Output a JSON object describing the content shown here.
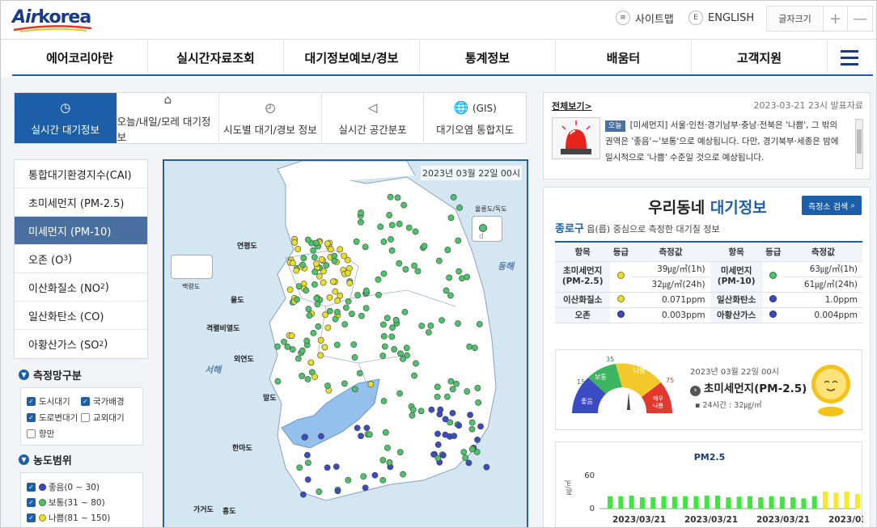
{
  "header": {
    "logo": "Airkorea",
    "sitemap": "사이트맵",
    "english": "ENGLISH",
    "english_icon": "E",
    "font_size": "글자크기",
    "font_plus": "+",
    "font_minus": "—"
  },
  "gnb": [
    "에어코리아란",
    "실시간자료조회",
    "대기정보예보/경보",
    "통계정보",
    "배움터",
    "고객지원"
  ],
  "tabs": [
    {
      "label": "실시간 대기정보",
      "icon": "clock-icon",
      "glyph": "◷"
    },
    {
      "label": "오늘/내일/모레 대기정보",
      "icon": "pin-icon",
      "glyph": "⌂"
    },
    {
      "label": "시도별 대기/경보 정보",
      "icon": "gauge-icon",
      "glyph": "◴"
    },
    {
      "label": "실시간 공간분포",
      "icon": "megaphone-icon",
      "glyph": "◁"
    },
    {
      "label": "대기오염 통합지도",
      "icon": "globe-icon",
      "glyph": "🌐",
      "gis": "(GIS)"
    }
  ],
  "left_menu": [
    {
      "label": "통합대기환경지수(CAI)"
    },
    {
      "label": "초미세먼지 (PM-2.5)"
    },
    {
      "label": "미세먼지 (PM-10)"
    },
    {
      "label": "오존 (O",
      "sub": "3",
      "end": ")"
    },
    {
      "label": "이산화질소 (NO",
      "sub": "2",
      "end": ")"
    },
    {
      "label": "일산화탄소 (CO)"
    },
    {
      "label": "아황산가스 (SO",
      "sub": "2",
      "end": ")"
    }
  ],
  "network": {
    "title": "측정망구분",
    "items": [
      {
        "label": "도시대기",
        "checked": true
      },
      {
        "label": "국가배경",
        "checked": true
      },
      {
        "label": "도로변대기",
        "checked": true
      },
      {
        "label": "교외대기",
        "checked": false
      },
      {
        "label": "항만",
        "checked": false
      }
    ]
  },
  "range": {
    "title": "농도범위",
    "items": [
      {
        "label": "좋음(0 ~ 30)",
        "color": "#3a4bc4",
        "checked": true
      },
      {
        "label": "보통(31 ~ 80)",
        "color": "#4cc36a",
        "checked": true
      },
      {
        "label": "나쁨(81 ~ 150)",
        "color": "#e8de2a",
        "checked": true
      }
    ]
  },
  "map": {
    "date": "2023년 03월 22일 00시",
    "labels": [
      "울릉도/독도",
      "연평도",
      "백령도",
      "울도",
      "격렬비열도",
      "외연도",
      "말도",
      "한마도",
      "가거도",
      "흥도"
    ],
    "seas": [
      "동해",
      "서해"
    ],
    "inset_text": "d"
  },
  "news": {
    "all": "전체보기>",
    "date": "2023-03-21 23시 발표자료",
    "badge": "오늘",
    "text": "[미세먼지] 서울·인천·경기남부·충남·전북은 '나쁨', 그 밖의 권역은 '좋음'~'보통'으로 예상됩니다. 다만, 경기북부·세종은 밤에 일시적으로 '나쁨' 수준일 것으로 예상됩니다."
  },
  "dong": {
    "title_a": "우리동네",
    "title_b": "대기정보",
    "search": "측정소 검색",
    "sub_region": "종로구",
    "sub_text": "읍(릅) 중심으로 측정한 대기질 정보",
    "headers": [
      "항목",
      "등급",
      "측정값",
      "항목",
      "등급",
      "측정값"
    ],
    "pm25": {
      "label": "초미세먼지\n(PM-2.5)",
      "v1": "39㎍/㎥(1h)",
      "v2": "32㎍/㎥(24h)",
      "color": "#e8de2a"
    },
    "pm10": {
      "label": "미세먼지\n(PM-10)",
      "v1": "63㎍/㎥(1h)",
      "v2": "61㎍/㎥(24h)",
      "color": "#4cc36a"
    },
    "no2": {
      "label": "이산화질소",
      "v": "0.071ppm",
      "color": "#e8de2a"
    },
    "co": {
      "label": "일산화탄소",
      "v": "1.0ppm",
      "color": "#3a4bc4"
    },
    "o3": {
      "label": "오존",
      "v": "0.003ppm",
      "color": "#3a4bc4"
    },
    "so2": {
      "label": "아황산가스",
      "v": "0.004ppm",
      "color": "#3a4bc4"
    }
  },
  "gauge": {
    "date": "2023년 03월 22일 00시",
    "name": "초미세먼지(PM-2.5)",
    "avg": "24시간 : 32㎍/㎥",
    "segments": [
      "좋음",
      "보통",
      "나쁨",
      "매우\n나쁨"
    ],
    "ticks": [
      "15",
      "35",
      "75"
    ]
  },
  "chart_data": {
    "type": "bar",
    "title": "PM2.5",
    "ylabel": "㎍/㎥",
    "yticks": [
      "60",
      "0"
    ],
    "ylim": [
      0,
      60
    ],
    "xlabels": [
      "2023/03/21",
      "2023/03/21",
      "2023/03/21",
      "2023/03/21"
    ],
    "values": [
      22,
      22,
      23,
      20,
      20,
      22,
      21,
      22,
      22,
      23,
      23,
      20,
      21,
      22,
      20,
      22,
      21,
      20,
      18,
      22,
      30,
      28,
      30,
      26,
      23,
      26,
      24
    ],
    "colors": [
      "g",
      "g",
      "g",
      "g",
      "g",
      "g",
      "g",
      "g",
      "g",
      "g",
      "g",
      "g",
      "g",
      "g",
      "g",
      "g",
      "g",
      "g",
      "g",
      "g",
      "y",
      "y",
      "y",
      "y",
      "y",
      "y",
      "y"
    ]
  }
}
